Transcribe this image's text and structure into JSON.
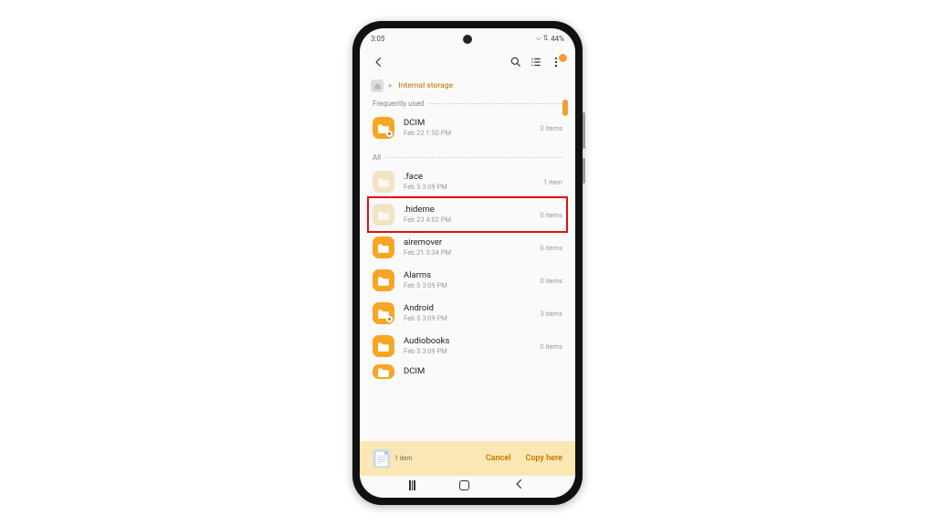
{
  "statusbar": {
    "time": "3:05",
    "battery": "44%",
    "icons": "⌵ ⇅"
  },
  "toolbar": {
    "back": "‹",
    "search": "search",
    "list": "list",
    "more": "more"
  },
  "breadcrumb": {
    "current": "Internal storage",
    "home_icon": "home"
  },
  "sections": {
    "frequent_label": "Frequently used",
    "all_label": "All"
  },
  "frequent": [
    {
      "name": "DCIM",
      "sub": "Feb 22 1:50 PM",
      "meta": "3 items",
      "style": "orange",
      "dot": true
    }
  ],
  "all": [
    {
      "name": ".face",
      "sub": "Feb 5 3:09 PM",
      "meta": "1 item",
      "style": "beige",
      "dot": false,
      "hl": false
    },
    {
      "name": ".hideme",
      "sub": "Feb 23 4:02 PM",
      "meta": "0 items",
      "style": "beige",
      "dot": false,
      "hl": true
    },
    {
      "name": "airemover",
      "sub": "Feb 21 3:34 PM",
      "meta": "0 items",
      "style": "orange",
      "dot": false,
      "hl": false
    },
    {
      "name": "Alarms",
      "sub": "Feb 5 3:09 PM",
      "meta": "0 items",
      "style": "orange",
      "dot": false,
      "hl": false
    },
    {
      "name": "Android",
      "sub": "Feb 5 3:09 PM",
      "meta": "3 items",
      "style": "orange",
      "dot": true,
      "hl": false
    },
    {
      "name": "Audiobooks",
      "sub": "Feb 5 3:09 PM",
      "meta": "0 items",
      "style": "orange",
      "dot": false,
      "hl": false
    },
    {
      "name": "DCIM",
      "sub": "",
      "meta": "",
      "style": "orange",
      "dot": false,
      "hl": false,
      "cut": true
    }
  ],
  "bottom": {
    "count": "1 item",
    "cancel": "Cancel",
    "copy": "Copy here"
  }
}
